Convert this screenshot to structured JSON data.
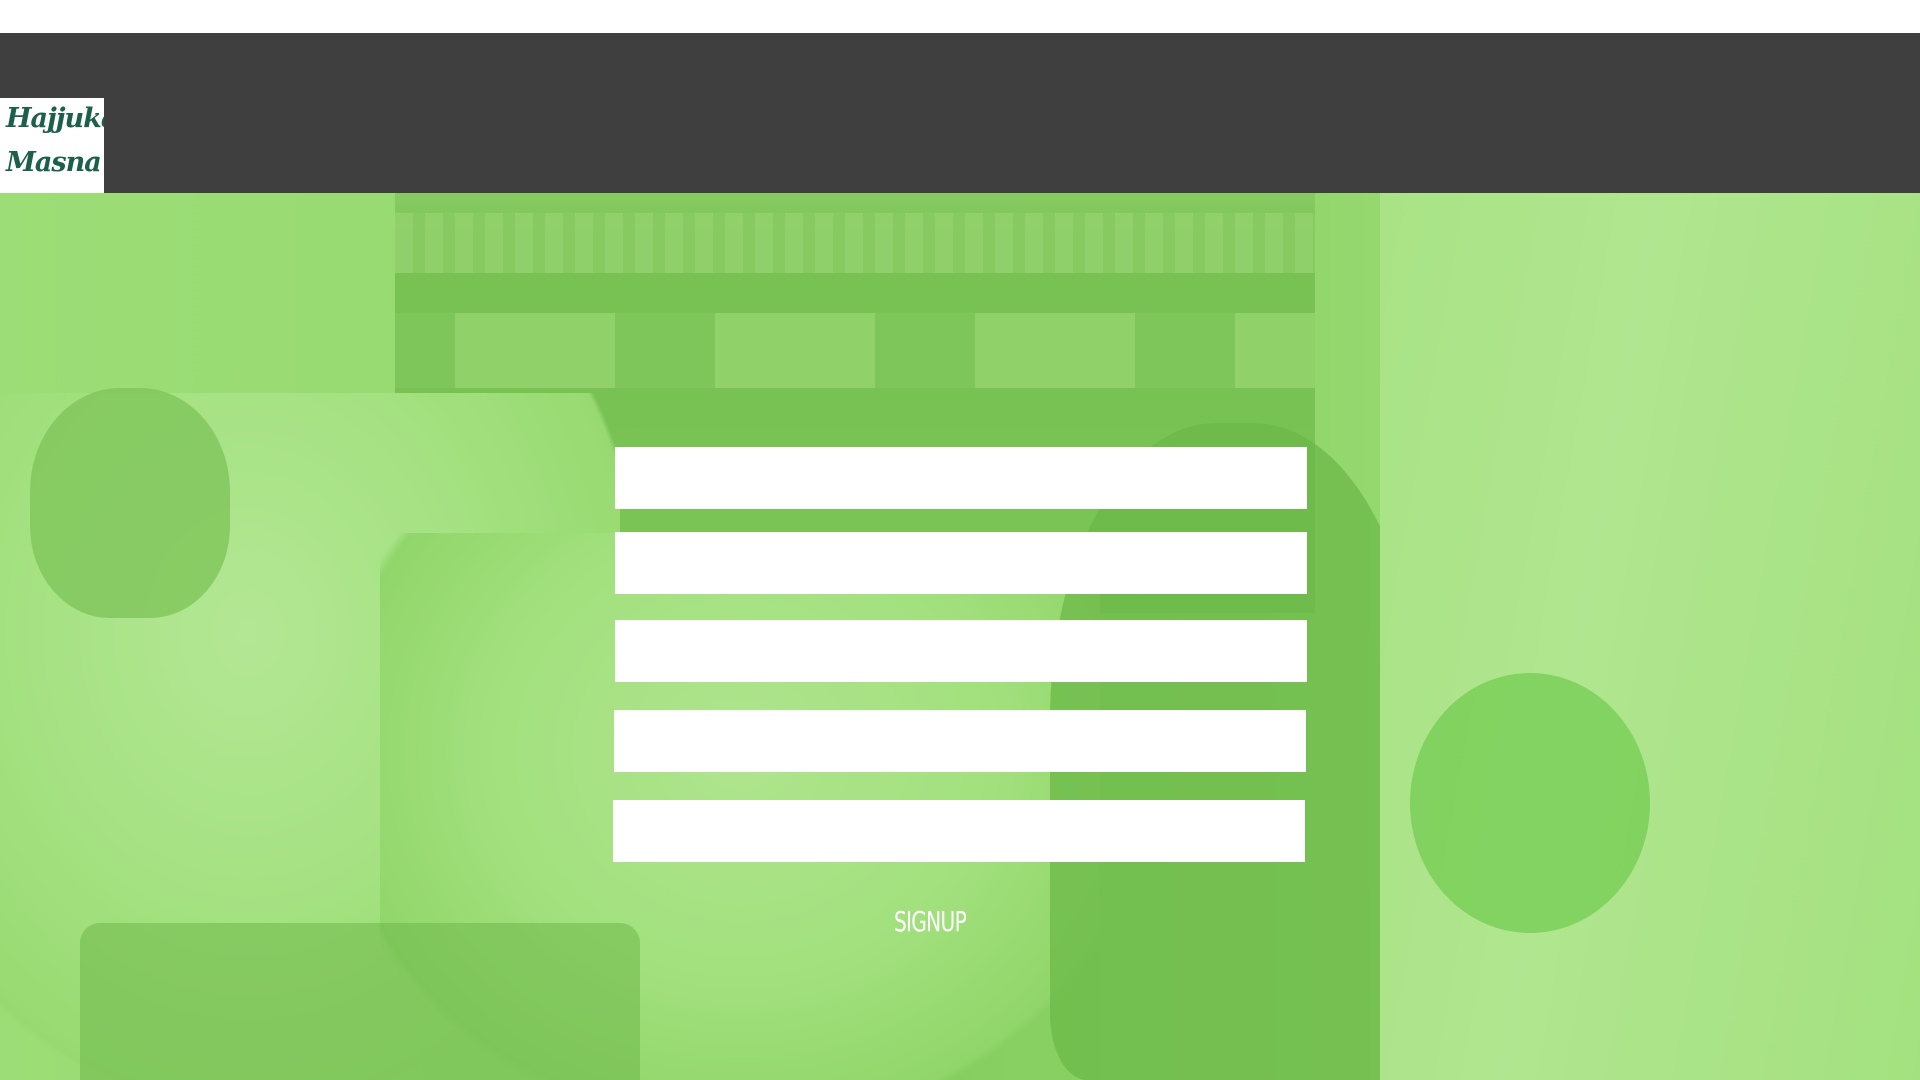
{
  "brand": {
    "logo_line1": "Hajjuka",
    "logo_line2": "Masna",
    "logo_color": "#1c5f4a"
  },
  "header": {
    "background_color": "#3f3f3f"
  },
  "hero": {
    "overlay_color": "#8fd56a"
  },
  "form": {
    "fields": [
      {
        "value": "",
        "placeholder": ""
      },
      {
        "value": "",
        "placeholder": ""
      },
      {
        "value": "",
        "placeholder": ""
      },
      {
        "value": "",
        "placeholder": ""
      },
      {
        "value": "",
        "placeholder": ""
      }
    ],
    "submit_label": "SIGNUP"
  }
}
